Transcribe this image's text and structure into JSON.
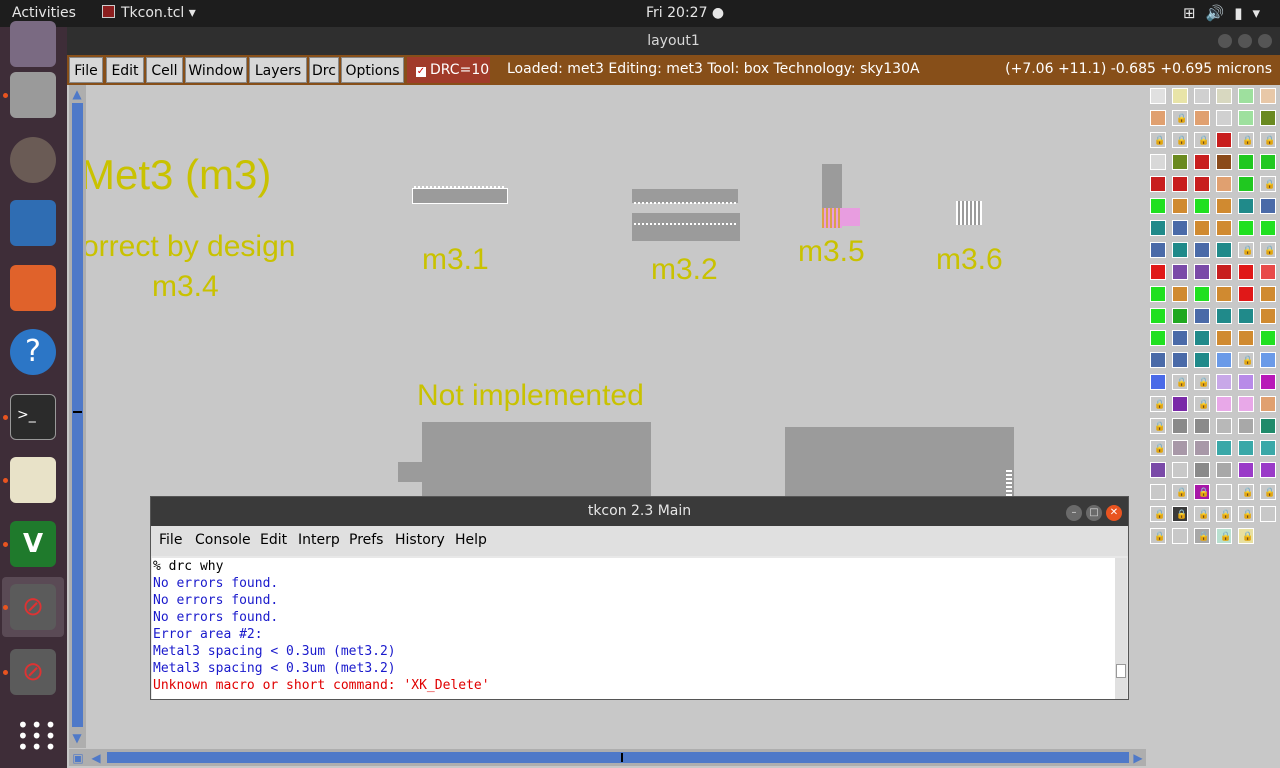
{
  "topbar": {
    "activities": "Activities",
    "app_name": "Tkcon.tcl",
    "clock": "Fri 20:27 ●"
  },
  "dock": {
    "items": [
      "mail",
      "files",
      "speaker",
      "writer",
      "software",
      "help",
      "terminal",
      "editor",
      "vim",
      "magic",
      "magic2"
    ]
  },
  "window": {
    "title": "layout1"
  },
  "magic_menu": {
    "items": [
      "File",
      "Edit",
      "Cell",
      "Window",
      "Layers",
      "Drc",
      "Options"
    ],
    "drc_label": "DRC=10",
    "status": "Loaded: met3 Editing: met3 Tool: box  Technology: sky130A",
    "coords": "(+7.06 +11.1) -0.685 +0.695 microns"
  },
  "canvas_labels": {
    "title": "Met3 (m3)",
    "correct": "orrect by design",
    "m34": "m3.4",
    "m31": "m3.1",
    "m32": "m3.2",
    "m35": "m3.5",
    "m36": "m3.6",
    "not_impl": "Not implemented"
  },
  "tkcon": {
    "title": "tkcon 2.3 Main",
    "menu": [
      "File",
      "Console",
      "Edit",
      "Interp",
      "Prefs",
      "History",
      "Help"
    ],
    "lines": [
      {
        "text": "% drc why",
        "color": "#000000"
      },
      {
        "text": "No errors found.",
        "color": "#1a1acc"
      },
      {
        "text": "No errors found.",
        "color": "#1a1acc"
      },
      {
        "text": "No errors found.",
        "color": "#1a1acc"
      },
      {
        "text": "Error area #2:",
        "color": "#1a1acc"
      },
      {
        "text": "Metal3 spacing < 0.3um (met3.2)",
        "color": "#1a1acc"
      },
      {
        "text": "Metal3 spacing < 0.3um (met3.2)",
        "color": "#1a1acc"
      },
      {
        "text": "Unknown macro or short command: 'XK_Delete'",
        "color": "#e00000"
      }
    ]
  },
  "colors": {
    "menubar": "#874f19",
    "label_yellow": "#c9c200",
    "dock": "#3e2d38"
  }
}
